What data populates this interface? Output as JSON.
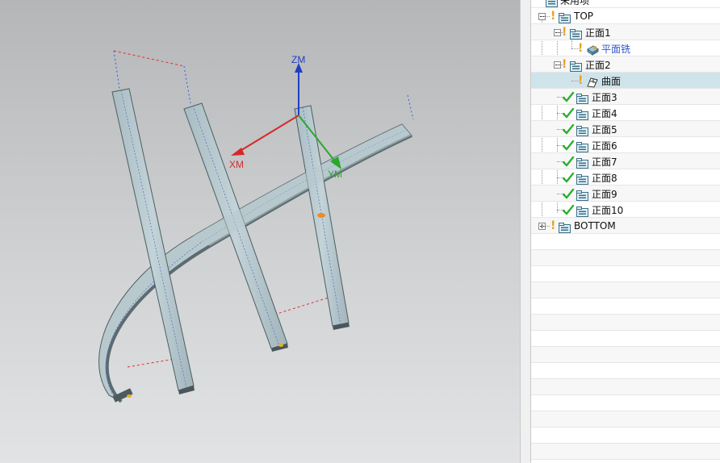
{
  "viewport": {
    "axes": {
      "z_label": "ZM",
      "x_label": "XM",
      "y_label": "YM"
    }
  },
  "tree": {
    "partial_top_label": "未用项",
    "nodes": [
      {
        "label": "TOP",
        "status": "warning",
        "expand": "minus",
        "icon": "folder-icon"
      },
      {
        "label": "正面1",
        "status": "warning",
        "expand": "minus",
        "icon": "folder-icon"
      },
      {
        "label": "平面铣",
        "status": "warning",
        "expand": "none",
        "icon": "planar-mill-icon",
        "style": "link"
      },
      {
        "label": "正面2",
        "status": "warning",
        "expand": "minus",
        "icon": "folder-icon"
      },
      {
        "label": "曲面",
        "status": "warning",
        "expand": "none",
        "icon": "surface-op-icon",
        "selected": true
      },
      {
        "label": "正面3",
        "status": "ok",
        "icon": "folder-icon"
      },
      {
        "label": "正面4",
        "status": "ok",
        "icon": "folder-icon"
      },
      {
        "label": "正面5",
        "status": "ok",
        "icon": "folder-icon"
      },
      {
        "label": "正面6",
        "status": "ok",
        "icon": "folder-icon"
      },
      {
        "label": "正面7",
        "status": "ok",
        "icon": "folder-icon"
      },
      {
        "label": "正面8",
        "status": "ok",
        "icon": "folder-icon"
      },
      {
        "label": "正面9",
        "status": "ok",
        "icon": "folder-icon"
      },
      {
        "label": "正面10",
        "status": "ok",
        "icon": "folder-icon"
      },
      {
        "label": "BOTTOM",
        "status": "warning",
        "expand": "plus",
        "icon": "folder-icon"
      }
    ]
  },
  "colors": {
    "warning": "#e8a21e",
    "ok": "#2bb12b",
    "link_text": "#3355cc",
    "selected_row": "#cfe4ea",
    "axis_x": "#d42a2a",
    "axis_y": "#2aa82a",
    "axis_z": "#1f3fc4"
  }
}
